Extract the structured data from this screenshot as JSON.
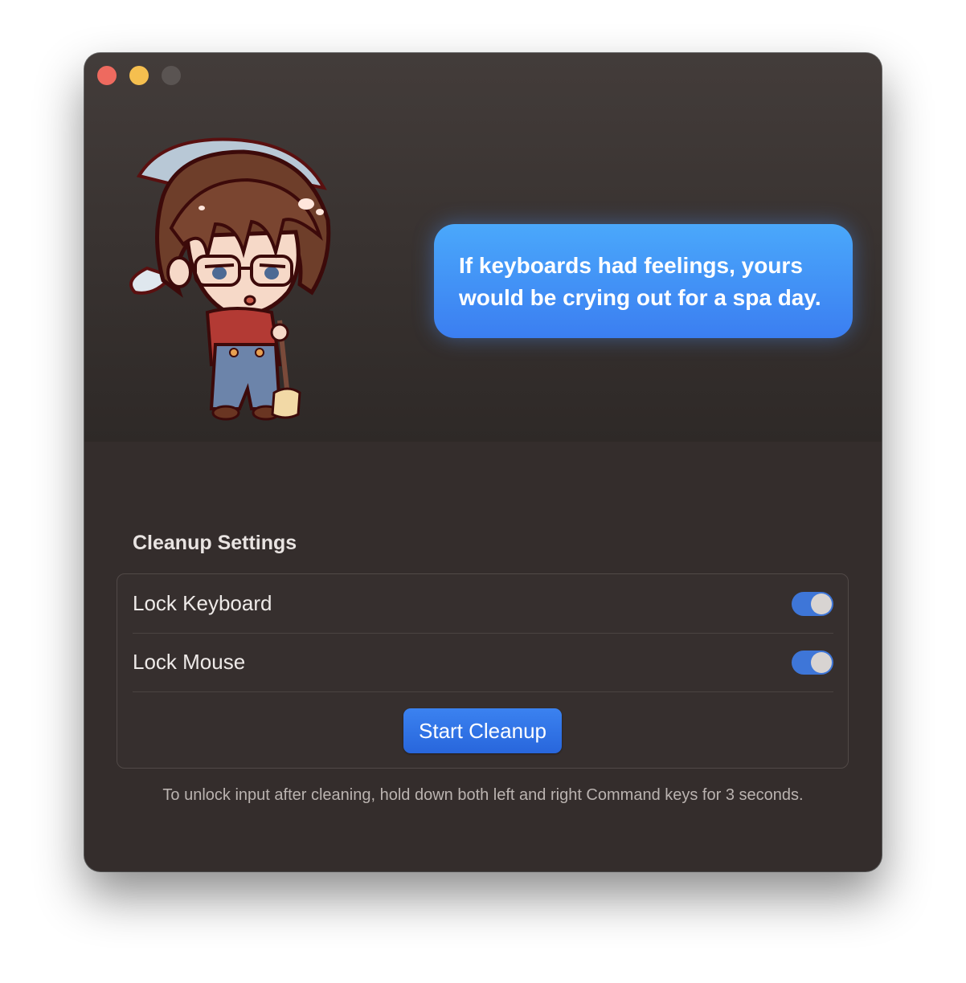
{
  "window": {
    "controls": {
      "close_icon": "close-icon",
      "minimize_icon": "minimize-icon",
      "zoom_icon": "zoom-icon"
    }
  },
  "hero": {
    "mascot_icon": "cleaning-character-illustration",
    "bubble_line1": "If keyboards had feelings, yours",
    "bubble_line2": "would be crying out for a spa day."
  },
  "settings": {
    "title": "Cleanup Settings",
    "items": [
      {
        "label": "Lock Keyboard",
        "enabled": true
      },
      {
        "label": "Lock Mouse",
        "enabled": true
      }
    ],
    "start_label": "Start Cleanup"
  },
  "footer": {
    "hint": "To unlock input after cleaning, hold down both left and right Command keys for 3 seconds."
  },
  "colors": {
    "accent": "#3e76d8",
    "bubble": "#4a94f6",
    "window_bg": "#342d2c"
  }
}
